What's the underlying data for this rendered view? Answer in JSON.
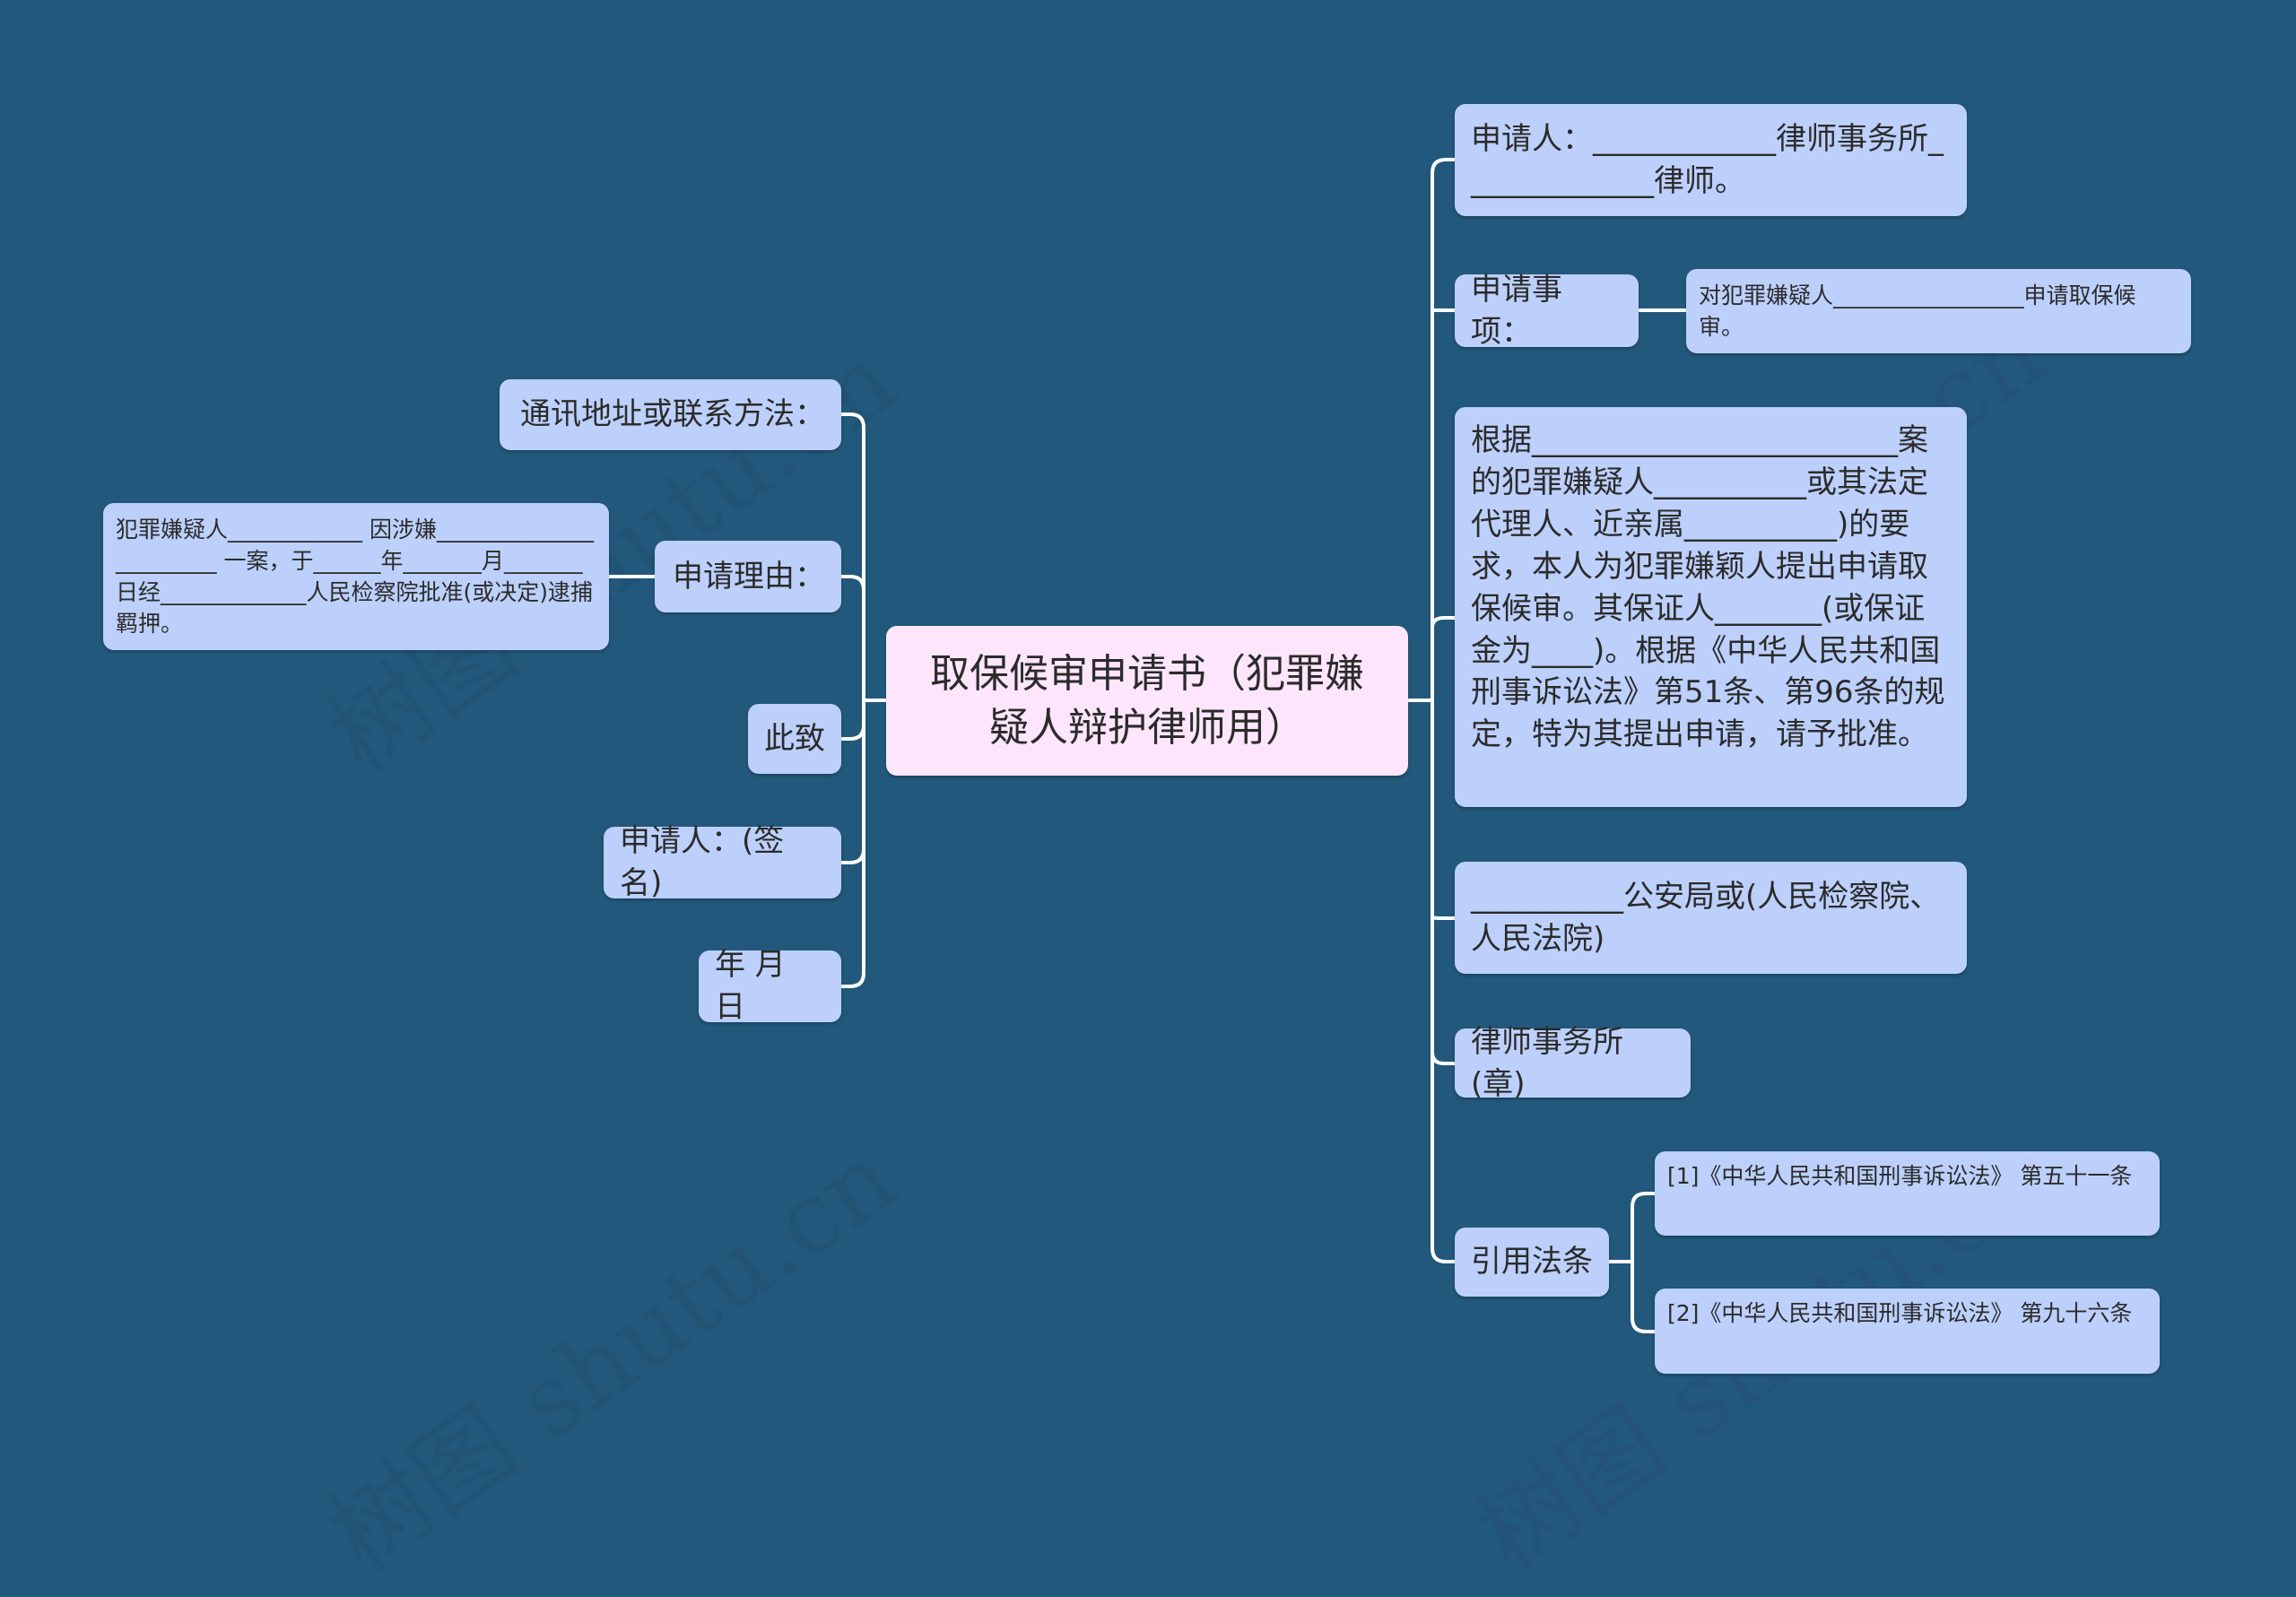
{
  "colors": {
    "background": "#22587b",
    "node_fill": "#bcd0fb",
    "root_fill": "#fde6fb",
    "connector": "#ffffff",
    "text": "#2b2b2b"
  },
  "watermark": "树图 shutu.cn",
  "root": {
    "title": "取保候审申请书（犯罪嫌疑人辩护律师用）"
  },
  "right_branches": [
    {
      "label": "申请人：____________律师事务所_____________律师。"
    },
    {
      "label": "申请事项：",
      "children": [
        {
          "label": "对犯罪嫌疑人_________________申请取保候审。"
        }
      ]
    },
    {
      "label": "根据________________________案的犯罪嫌疑人__________或其法定代理人、近亲属__________)的要求，本人为犯罪嫌颖人提出申请取保候审。其保证人_______(或保证金为____)。根据《中华人民共和国刑事诉讼法》第51条、第96条的规定，特为其提出申请，请予批准。"
    },
    {
      "label": "__________公安局或(人民检察院、人民法院)"
    },
    {
      "label": "律师事务所(章)"
    },
    {
      "label": "引用法条",
      "children": [
        {
          "label": "[1]《中华人民共和国刑事诉讼法》 第五十一条"
        },
        {
          "label": "[2]《中华人民共和国刑事诉讼法》 第九十六条"
        }
      ]
    }
  ],
  "left_branches": [
    {
      "label": "通讯地址或联系方法："
    },
    {
      "label": "申请理由：",
      "children": [
        {
          "label": "犯罪嫌疑人____________ 因涉嫌_______________________ 一案，于______年_______月_______日经_____________人民检察院批准(或决定)逮捕羁押。"
        }
      ]
    },
    {
      "label": "此致"
    },
    {
      "label": "申请人：(签名)"
    },
    {
      "label": "年 月 日"
    }
  ]
}
